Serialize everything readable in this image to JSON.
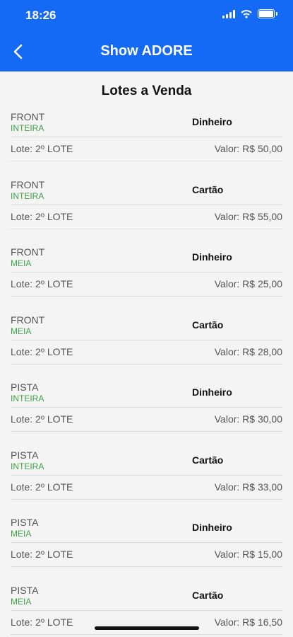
{
  "status_bar": {
    "time": "18:26"
  },
  "header": {
    "title": "Show ADORE"
  },
  "section_title": "Lotes a Venda",
  "colors": {
    "header_bg": "#1469f5",
    "ticket_type": "#3fa24a"
  },
  "items": [
    {
      "sector": "FRONT",
      "type": "INTEIRA",
      "payment": "Dinheiro",
      "lote": "Lote: 2º LOTE",
      "price": "Valor: R$ 50,00"
    },
    {
      "sector": "FRONT",
      "type": "INTEIRA",
      "payment": "Cartão",
      "lote": "Lote: 2º LOTE",
      "price": "Valor: R$ 55,00"
    },
    {
      "sector": "FRONT",
      "type": "MEIA",
      "payment": "Dinheiro",
      "lote": "Lote: 2º LOTE",
      "price": "Valor: R$ 25,00"
    },
    {
      "sector": "FRONT",
      "type": "MEIA",
      "payment": "Cartão",
      "lote": "Lote: 2º LOTE",
      "price": "Valor: R$ 28,00"
    },
    {
      "sector": "PISTA",
      "type": "INTEIRA",
      "payment": "Dinheiro",
      "lote": "Lote: 2º LOTE",
      "price": "Valor: R$ 30,00"
    },
    {
      "sector": "PISTA",
      "type": "INTEIRA",
      "payment": "Cartão",
      "lote": "Lote: 2º LOTE",
      "price": "Valor: R$ 33,00"
    },
    {
      "sector": "PISTA",
      "type": "MEIA",
      "payment": "Dinheiro",
      "lote": "Lote: 2º LOTE",
      "price": "Valor: R$ 15,00"
    },
    {
      "sector": "PISTA",
      "type": "MEIA",
      "payment": "Cartão",
      "lote": "Lote: 2º LOTE",
      "price": "Valor: R$ 16,50"
    }
  ]
}
